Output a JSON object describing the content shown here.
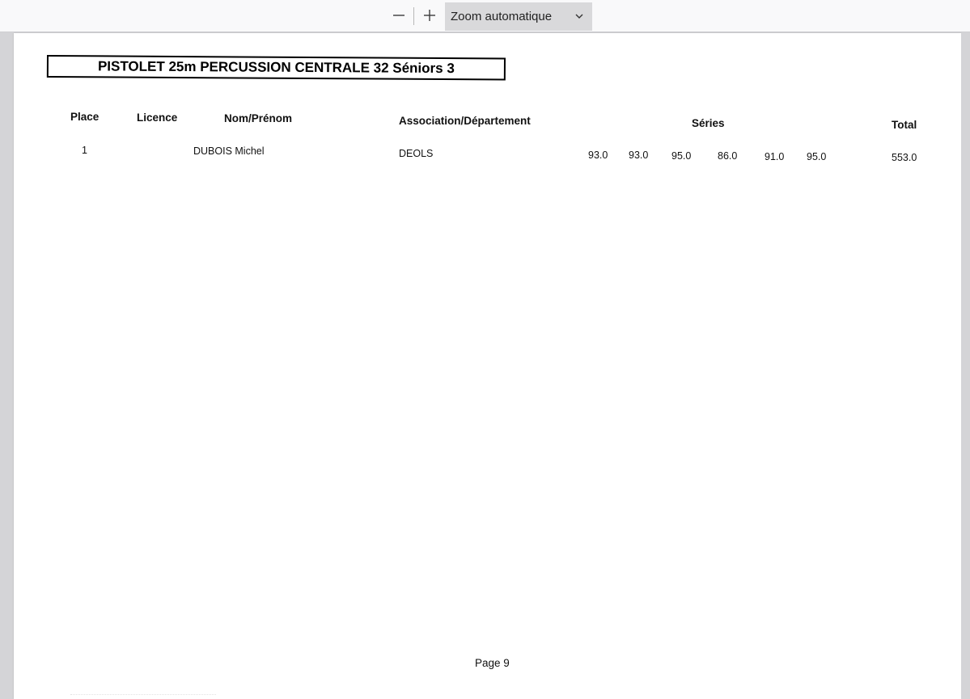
{
  "toolbar": {
    "zoom_out_icon": "minus-icon",
    "zoom_in_icon": "plus-icon",
    "zoom_value": "Zoom automatique"
  },
  "document": {
    "title": "PISTOLET 25m PERCUSSION CENTRALE 32 Séniors 3",
    "headers": {
      "place": "Place",
      "licence": "Licence",
      "name": "Nom/Prénom",
      "association": "Association/Département",
      "series": "Séries",
      "total": "Total"
    },
    "rows": [
      {
        "place": "1",
        "licence": "",
        "name": "DUBOIS Michel",
        "association": "DEOLS",
        "series": [
          "93.0",
          "93.0",
          "95.0",
          "86.0",
          "91.0",
          "95.0"
        ],
        "total": "553.0"
      }
    ],
    "footer": "Page 9"
  }
}
